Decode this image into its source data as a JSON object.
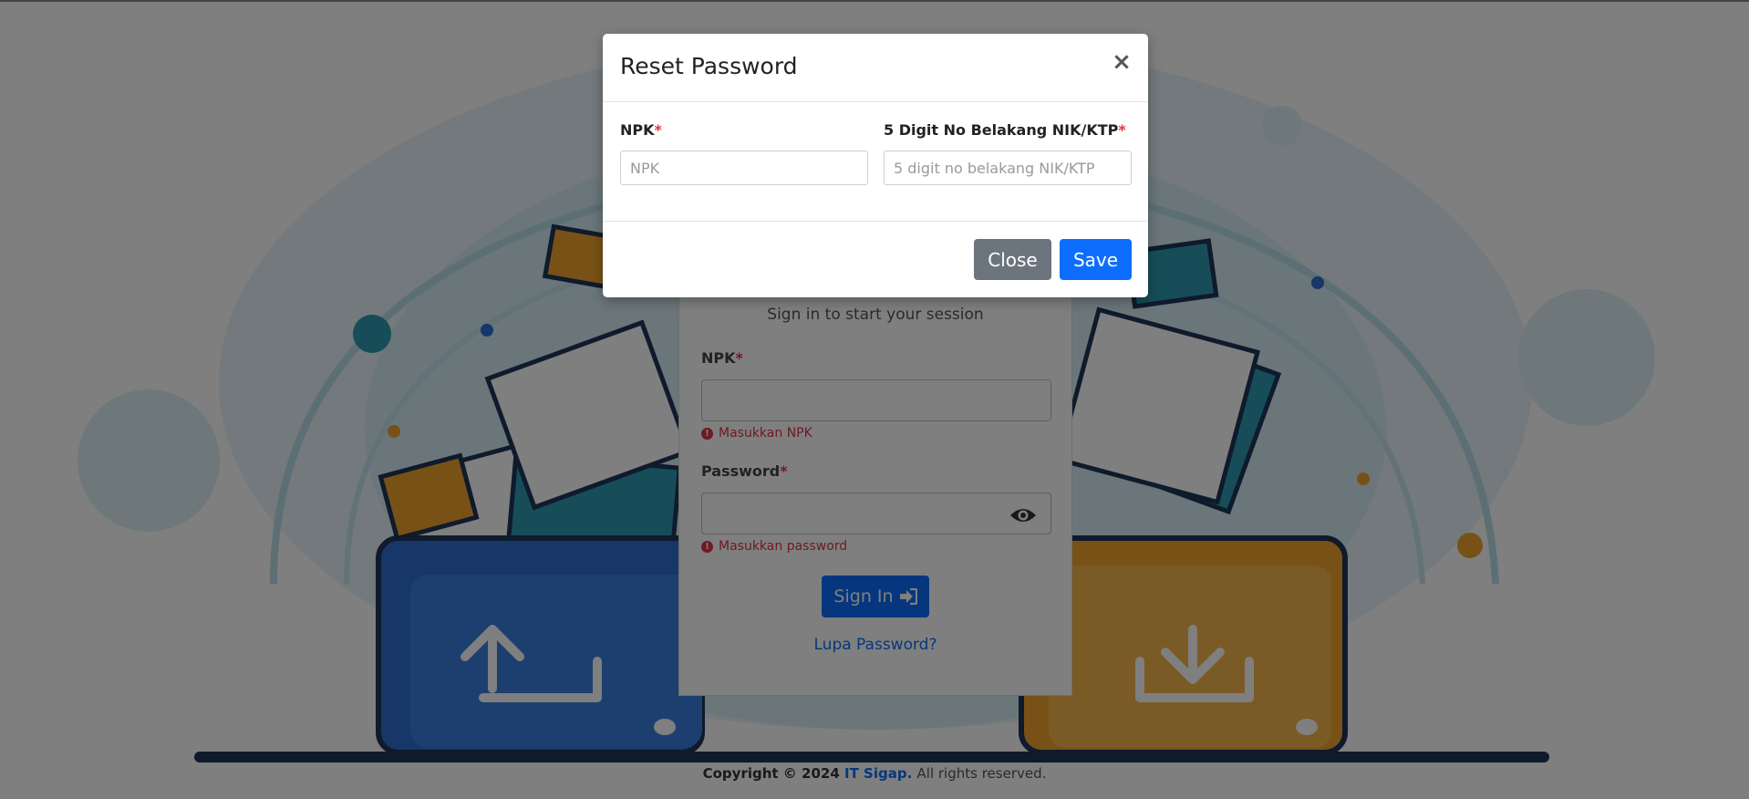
{
  "login": {
    "message": "Sign in to start your session",
    "npk_label": "NPK",
    "required_mark": "*",
    "npk_value": "",
    "npk_error": "Masukkan NPK",
    "password_label": "Password",
    "password_value": "",
    "password_error": "Masukkan password",
    "signin_label": "Sign In",
    "forgot_link": "Lupa Password?"
  },
  "footer": {
    "copyright": "Copyright © 2024",
    "brand": "IT Sigap.",
    "rights": "All rights reserved."
  },
  "modal": {
    "title": "Reset Password",
    "close_symbol": "×",
    "npk_label": "NPK",
    "npk_placeholder": "NPK",
    "nik_label": "5 Digit No Belakang NIK/KTP",
    "nik_placeholder": "5 digit no belakang NIK/KTP",
    "required_mark": "*",
    "close_button": "Close",
    "save_button": "Save"
  },
  "icons": {
    "error": "exclamation-circle-icon",
    "eye": "eye-icon",
    "signin": "sign-in-icon"
  },
  "colors": {
    "primary": "#0d6efd",
    "secondary": "#6c757d",
    "danger": "#dc3545",
    "backdrop": "rgba(0,0,0,0.5)"
  }
}
